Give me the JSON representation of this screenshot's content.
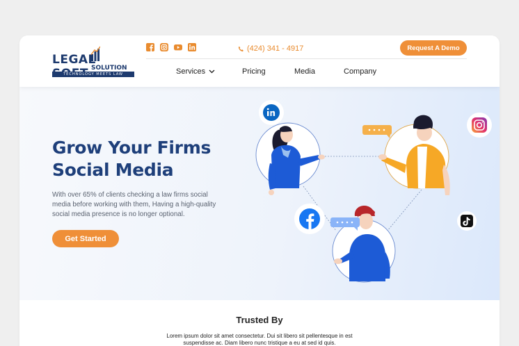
{
  "brand": {
    "logo_word_left": "LEGAL",
    "logo_word_right": "OFT",
    "logo_s": "S",
    "logo_sub": "SOLUTION",
    "logo_tagline": "TECHNOLOGY MEETS LAW"
  },
  "header": {
    "socials": [
      "facebook-icon",
      "instagram-icon",
      "youtube-icon",
      "linkedin-icon"
    ],
    "phone": "(424) 341 - 4917",
    "demo_label": "Request A Demo",
    "nav": {
      "services": "Services",
      "pricing": "Pricing",
      "media": "Media",
      "company": "Company"
    }
  },
  "hero": {
    "title": "Grow Your Firms Social Media",
    "description": "With over 65% of clients checking a law firms social media before working with them, Having a high-quality social media presence is no longer optional.",
    "cta_label": "Get Started",
    "floating_icons": [
      "linkedin-icon",
      "instagram-icon",
      "facebook-icon",
      "tiktok-icon"
    ]
  },
  "trusted": {
    "heading": "Trusted By",
    "text": "Lorem ipsum dolor sit amet consectetur. Dui sit libero sit pellentesque in est suspendisse ac. Diam libero nunc tristique a eu at sed id quis."
  },
  "colors": {
    "accent": "#ef8f38",
    "brand_blue": "#1e3f7a",
    "hero_bg_end": "#dbe8fb"
  }
}
